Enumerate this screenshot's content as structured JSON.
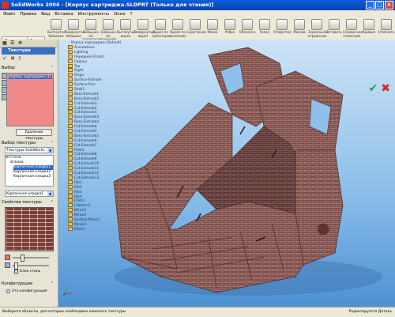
{
  "window": {
    "title": "SolidWorks 2004 - [Корпус картриджа.SLDPRT (Только для чтения)]",
    "buttons": [
      "_",
      "□",
      "×"
    ]
  },
  "menu": [
    "Файл",
    "Правка",
    "Вид",
    "Вставка",
    "Инструменты",
    "Окно",
    "?"
  ],
  "toolbar": {
    "tabs": [
      "Элементы",
      "Эскиз"
    ],
    "buttons": [
      "Вытянутая бобышка",
      "Повернутая бобышка",
      "Бобышка по траектории",
      "Бобышка по сечениям",
      "Вытянутый вырез",
      "Повернутый вырез",
      "Вырез по траектории",
      "Вырез по сечениям",
      "Скругление",
      "Фаска",
      "Ребро",
      "Оболочка",
      "Уклон",
      "Отверстие",
      "Массив",
      "Зеркальное отражение",
      "Вставить",
      "Справочная геометрия",
      "Кривые",
      "Отменить"
    ]
  },
  "left_panel": {
    "header": "Текстура",
    "section_selection": "Выбор",
    "selected_value": "Корпус картриджа (1)",
    "remove_button": "Удаление текстуры",
    "section_choose": "Выбор текстуры",
    "texture_source": "Текстуры SolidWorks",
    "tree_items": [
      "Стена",
      "Блок",
      "Кирпичная кладка1",
      "Кирпичная кладка2",
      "Кирпичная кладка3"
    ],
    "selected_texture_value": "Кирпичная кладка1",
    "section_props": "Свойства текстуры",
    "scale_checkbox_label": "Блок стиль",
    "section_config": "Конфигурации",
    "config_option": "Эта конфигурация"
  },
  "feature_tree": {
    "header": "Корпус картриджа (Default)",
    "items": [
      "Annotations",
      "Lighting",
      "Передняя (Front)",
      "Сверху",
      "Top",
      "Right",
      "Origin",
      "Surface-Extrude",
      "Surface-Trim",
      "Shell1",
      "Boss-Extrude1",
      "Boss-Extrude2",
      "Cut-Extrude1",
      "Cut-Extrude2",
      "Cut-Extrude3",
      "Boss-Extrude3",
      "Boss-Extrude4",
      "Cut-Extrude4",
      "Cut-Extrude5",
      "Boss-Extrude5",
      "Cut-Extrude6",
      "Cut-Extrude7",
      "Fillet1",
      "Cut-Extrude8",
      "Cut-Extrude9",
      "Cut-Extrude10",
      "Cut-Extrude11",
      "Cut-Extrude12",
      "Cut-Extrude13",
      "Rib1",
      "Rib2",
      "Rib3",
      "Rib4",
      "Fillet2",
      "LPattern1",
      "Mirror1",
      "Mirror2",
      "Surface-Plane1",
      "Mirror3",
      "Fillet3"
    ]
  },
  "status": {
    "hint": "Выберите объекты, для которых необходимо изменить текстуры",
    "right": "Редактируется Деталь"
  },
  "colors": {
    "accent": "#3a6fc6",
    "selection_box": "#f08a8a",
    "model": "#7f4a45"
  }
}
